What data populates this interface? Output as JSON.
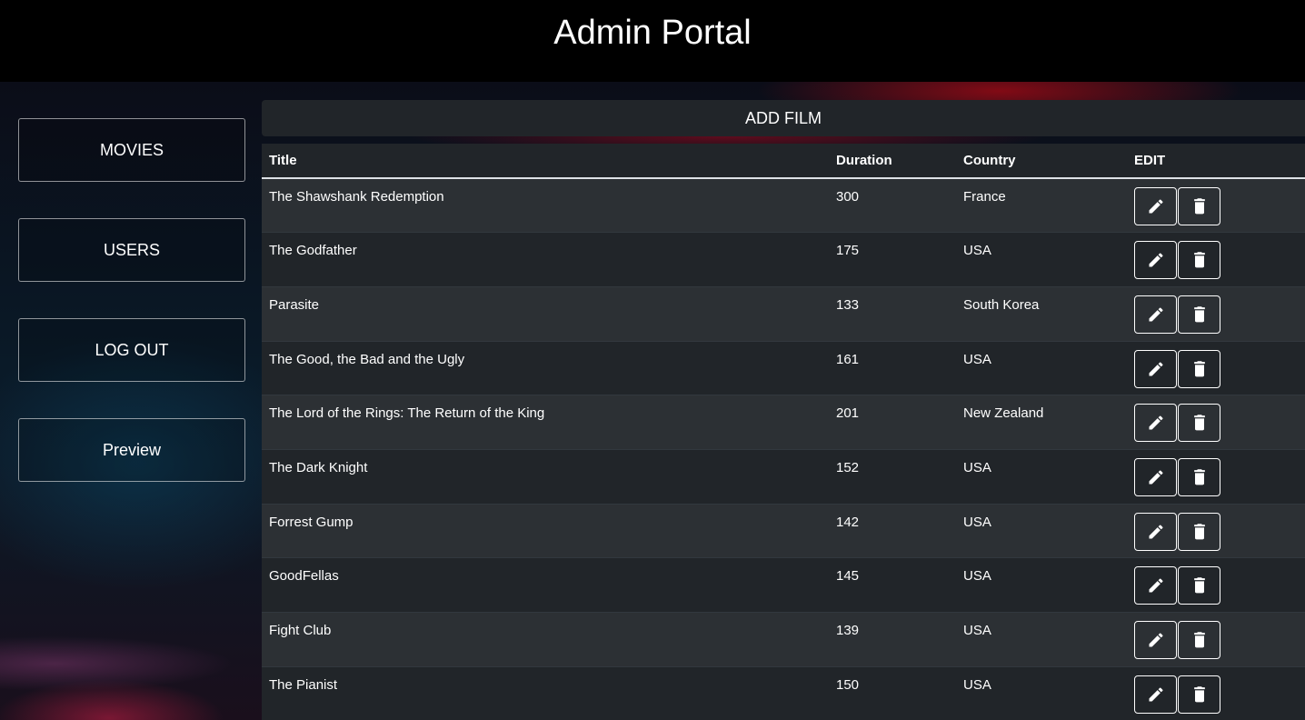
{
  "header": {
    "title": "Admin Portal"
  },
  "sidebar": {
    "items": [
      {
        "label": "MOVIES"
      },
      {
        "label": "USERS"
      },
      {
        "label": "LOG OUT"
      },
      {
        "label": "Preview"
      }
    ]
  },
  "main": {
    "add_film_label": "ADD FILM",
    "table": {
      "columns": [
        "Title",
        "Duration",
        "Country",
        "EDIT"
      ],
      "rows": [
        {
          "title": "The Shawshank Redemption",
          "duration": "300",
          "country": "France"
        },
        {
          "title": "The Godfather",
          "duration": "175",
          "country": "USA"
        },
        {
          "title": "Parasite",
          "duration": "133",
          "country": "South Korea"
        },
        {
          "title": "The Good, the Bad and the Ugly",
          "duration": "161",
          "country": "USA"
        },
        {
          "title": "The Lord of the Rings: The Return of the King",
          "duration": "201",
          "country": "New Zealand"
        },
        {
          "title": "The Dark Knight",
          "duration": "152",
          "country": "USA"
        },
        {
          "title": "Forrest Gump",
          "duration": "142",
          "country": "USA"
        },
        {
          "title": "GoodFellas",
          "duration": "145",
          "country": "USA"
        },
        {
          "title": "Fight Club",
          "duration": "139",
          "country": "USA"
        },
        {
          "title": "The Pianist",
          "duration": "150",
          "country": "USA"
        }
      ],
      "row_icons": {
        "edit": "pencil-icon",
        "delete": "trash-icon"
      }
    }
  }
}
